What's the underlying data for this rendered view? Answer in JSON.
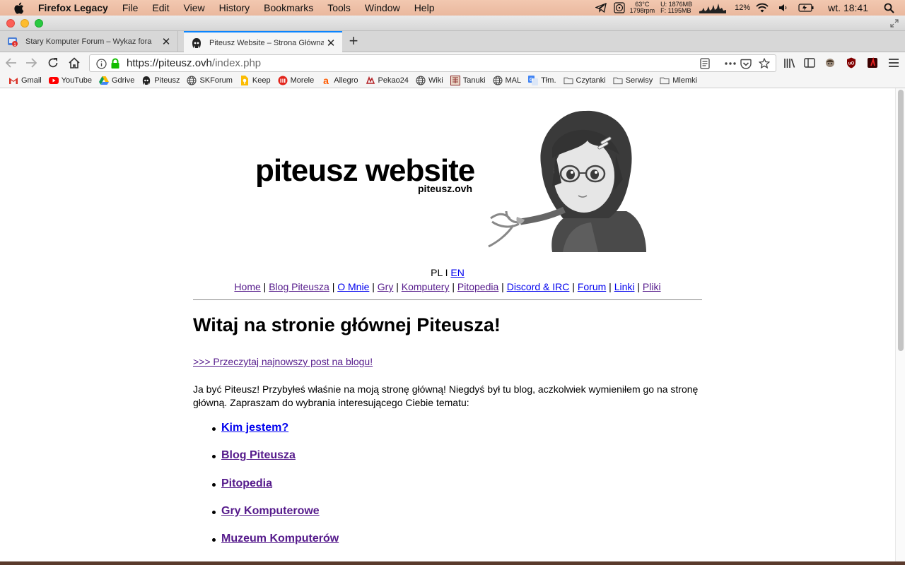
{
  "menubar": {
    "app_name": "Firefox Legacy",
    "items": [
      "File",
      "Edit",
      "View",
      "History",
      "Bookmarks",
      "Tools",
      "Window",
      "Help"
    ],
    "temp": "63°C",
    "fan": "1798rpm",
    "mem_used": "U: 1876MB",
    "mem_free": "F: 1195MB",
    "battery": "12%",
    "clock": "wt. 18:41"
  },
  "tabs": [
    {
      "title": "Stary Komputer Forum – Wykaz fora",
      "active": false
    },
    {
      "title": "Piteusz Website – Strona Główna",
      "active": true
    }
  ],
  "navbar": {
    "url_host": "https://piteusz.ovh",
    "url_path": "/index.php"
  },
  "bookmarks": [
    {
      "label": "Gmail",
      "icon": "gmail-icon"
    },
    {
      "label": "YouTube",
      "icon": "youtube-icon"
    },
    {
      "label": "Gdrive",
      "icon": "gdrive-icon"
    },
    {
      "label": "Piteusz",
      "icon": "piteusz-icon"
    },
    {
      "label": "SKForum",
      "icon": "globe-icon"
    },
    {
      "label": "Keep",
      "icon": "keep-icon"
    },
    {
      "label": "Morele",
      "icon": "morele-icon"
    },
    {
      "label": "Allegro",
      "icon": "allegro-icon"
    },
    {
      "label": "Pekao24",
      "icon": "pekao-icon"
    },
    {
      "label": "Wiki",
      "icon": "globe-icon"
    },
    {
      "label": "Tanuki",
      "icon": "tanuki-icon"
    },
    {
      "label": "MAL",
      "icon": "globe-icon"
    },
    {
      "label": "Tłm.",
      "icon": "translate-icon"
    },
    {
      "label": "Czytanki",
      "icon": "folder-icon"
    },
    {
      "label": "Serwisy",
      "icon": "folder-icon"
    },
    {
      "label": "Mlemki",
      "icon": "folder-icon"
    }
  ],
  "page": {
    "logo_title": "piteusz website",
    "logo_sub": "piteusz.ovh",
    "lang_current": "PL",
    "lang_sep": " I ",
    "lang_other": "EN",
    "nav": [
      {
        "label": "Home",
        "visited": true
      },
      {
        "label": "Blog Piteusza",
        "visited": true
      },
      {
        "label": "O Mnie",
        "visited": false
      },
      {
        "label": "Gry",
        "visited": true
      },
      {
        "label": "Komputery",
        "visited": true
      },
      {
        "label": "Pitopedia",
        "visited": true
      },
      {
        "label": "Discord & IRC",
        "visited": false
      },
      {
        "label": "Forum",
        "visited": false
      },
      {
        "label": "Linki",
        "visited": false
      },
      {
        "label": "Pliki",
        "visited": true
      }
    ],
    "nav_sep": " | ",
    "heading": "Witaj na stronie głównej Piteusza!",
    "latest_link": ">>> Przeczytaj najnowszy post na blogu!",
    "intro": "Ja być Piteusz! Przybyłeś właśnie na moją stronę główną! Niegdyś był tu blog, aczkolwiek wymieniłem go na stronę główną. Zapraszam do wybrania interesującego Ciebie tematu:",
    "topics": [
      {
        "label": "Kim jestem?",
        "visited": false
      },
      {
        "label": "Blog Piteusza",
        "visited": true
      },
      {
        "label": "Pitopedia",
        "visited": true
      },
      {
        "label": "Gry Komputerowe",
        "visited": true
      },
      {
        "label": "Muzeum Komputerów",
        "visited": true
      }
    ]
  }
}
